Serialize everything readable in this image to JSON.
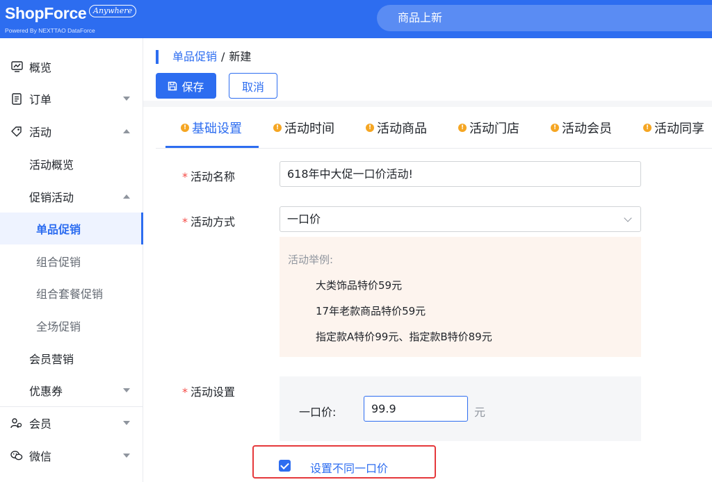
{
  "brand": {
    "name": "ShopForce",
    "badge": "Anywhere",
    "powered": "Powered By NEXTTAO DataForce"
  },
  "top_search": {
    "text": "商品上新"
  },
  "sidebar": {
    "items": [
      {
        "label": "概览",
        "icon": "chart-line-icon"
      },
      {
        "label": "订单",
        "icon": "document-icon"
      },
      {
        "label": "活动",
        "icon": "tag-icon"
      },
      {
        "label": "活动概览"
      },
      {
        "label": "促销活动"
      },
      {
        "label": "单品促销"
      },
      {
        "label": "组合促销"
      },
      {
        "label": "组合套餐促销"
      },
      {
        "label": "全场促销"
      },
      {
        "label": "会员营销"
      },
      {
        "label": "优惠券"
      },
      {
        "label": "会员",
        "icon": "user-group-icon"
      },
      {
        "label": "微信",
        "icon": "wechat-icon"
      }
    ]
  },
  "breadcrumb": {
    "parent": "单品促销",
    "separator": "/",
    "current": "新建"
  },
  "toolbar": {
    "save_label": "保存",
    "cancel_label": "取消"
  },
  "tabs": [
    {
      "label": "基础设置",
      "active": true
    },
    {
      "label": "活动时间"
    },
    {
      "label": "活动商品"
    },
    {
      "label": "活动门店"
    },
    {
      "label": "活动会员"
    },
    {
      "label": "活动同享"
    }
  ],
  "form": {
    "name_label": "活动名称",
    "name_value": "618年中大促一口价活动!",
    "mode_label": "活动方式",
    "mode_value": "一口价",
    "example_title": "活动举例:",
    "examples": [
      "大类饰品特价59元",
      "17年老款商品特价59元",
      "指定款A特价99元、指定款B特价89元"
    ],
    "setting_label": "活动设置",
    "price_label": "一口价:",
    "price_value": "99.9",
    "price_unit": "元",
    "diff_price_checkbox_label": "设置不同一口价",
    "diff_price_checked": true
  },
  "colors": {
    "primary": "#2d6df0",
    "required": "#f54a45",
    "warning_dot": "#f5a623",
    "highlight": "#e5383b"
  }
}
